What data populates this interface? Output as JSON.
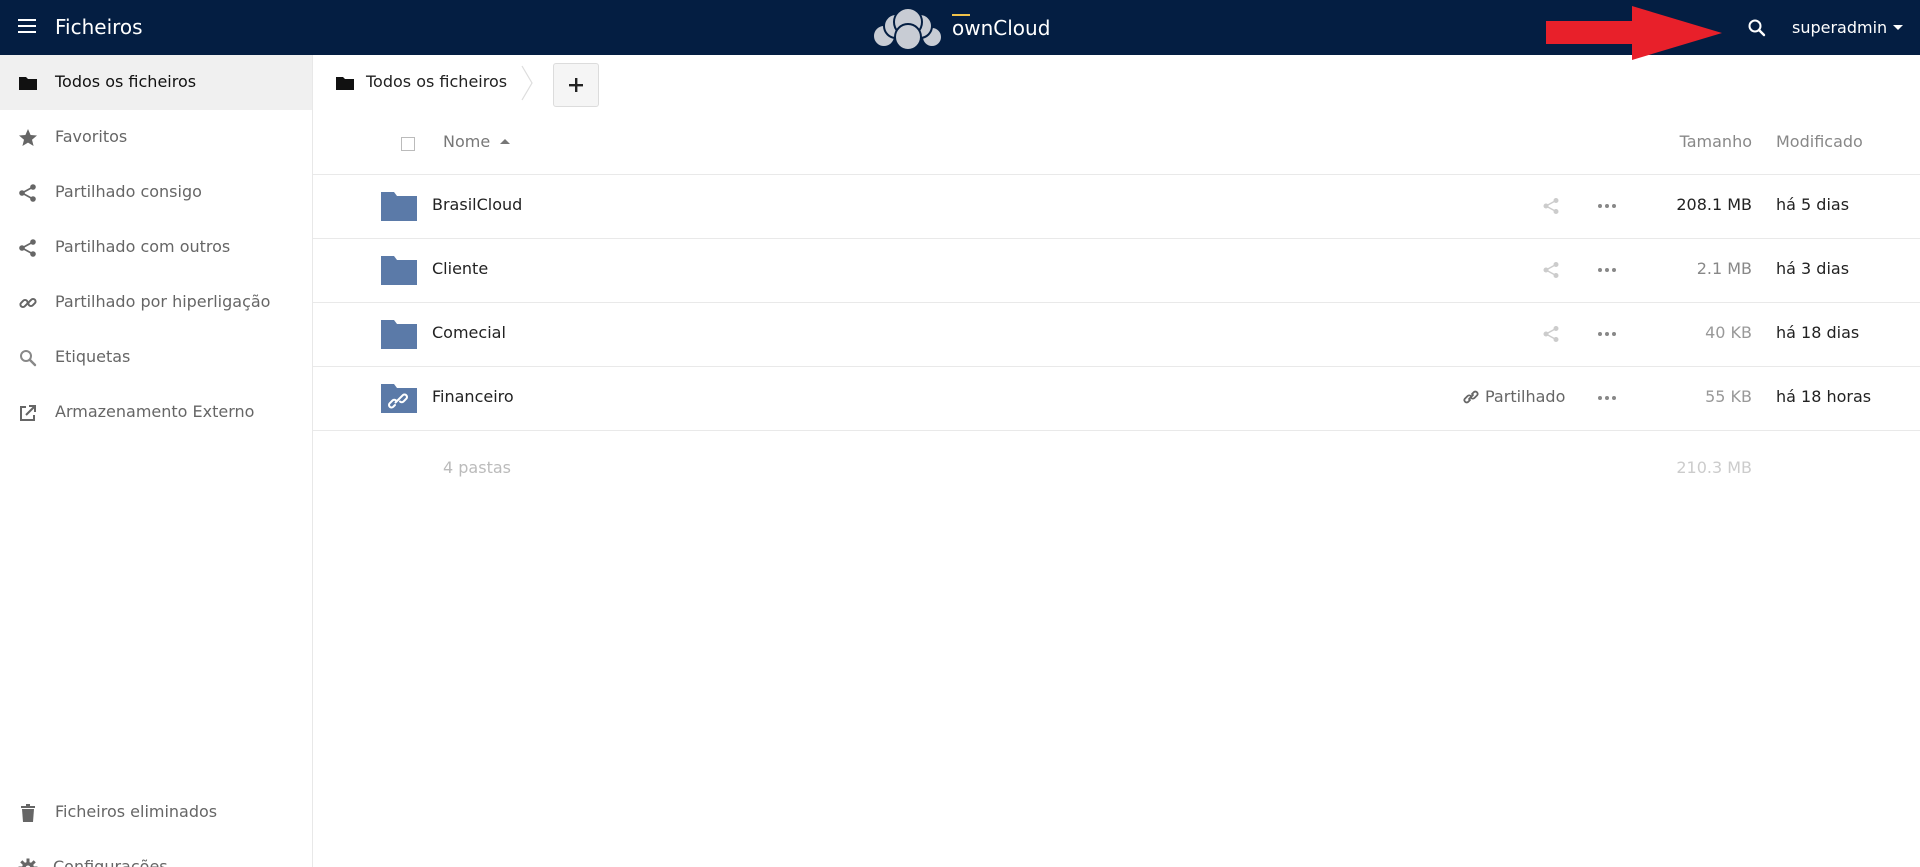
{
  "header": {
    "app_title": "Ficheiros",
    "logo_text": "ownCloud",
    "user": "superadmin",
    "bg_color": "#041e42",
    "annotation_arrow_color": "#e8202a"
  },
  "sidebar": {
    "items": [
      {
        "label": "Todos os ficheiros",
        "icon": "folder-icon",
        "active": true
      },
      {
        "label": "Favoritos",
        "icon": "star-icon",
        "active": false
      },
      {
        "label": "Partilhado consigo",
        "icon": "share-icon",
        "active": false
      },
      {
        "label": "Partilhado com outros",
        "icon": "share-icon",
        "active": false
      },
      {
        "label": "Partilhado por hiperligação",
        "icon": "link-icon",
        "active": false
      },
      {
        "label": "Etiquetas",
        "icon": "tag-search-icon",
        "active": false
      },
      {
        "label": "Armazenamento Externo",
        "icon": "external-link-icon",
        "active": false
      }
    ],
    "bottom": [
      {
        "label": "Ficheiros eliminados",
        "icon": "trash-icon"
      },
      {
        "label": "Configurações",
        "icon": "gear-icon"
      }
    ]
  },
  "breadcrumb": {
    "label": "Todos os ficheiros",
    "add_label": "+"
  },
  "table": {
    "headers": {
      "name": "Nome",
      "size": "Tamanho",
      "modified": "Modificado"
    },
    "rows": [
      {
        "name": "BrasilCloud",
        "size": "208.1 MB",
        "modified": "há 5 dias",
        "shared": false,
        "size_color": "#222222"
      },
      {
        "name": "Cliente",
        "size": "2.1 MB",
        "modified": "há 3 dias",
        "shared": false,
        "size_color": "#888888"
      },
      {
        "name": "Comecial",
        "size": "40 KB",
        "modified": "há 18 dias",
        "shared": false,
        "size_color": "#999999"
      },
      {
        "name": "Financeiro",
        "size": "55 KB",
        "modified": "há 18 horas",
        "shared": true,
        "shared_label": "Partilhado",
        "size_color": "#999999"
      }
    ],
    "summary": {
      "count": "4 pastas",
      "size": "210.3 MB"
    }
  },
  "colors": {
    "folder": "#5b7aa8"
  }
}
